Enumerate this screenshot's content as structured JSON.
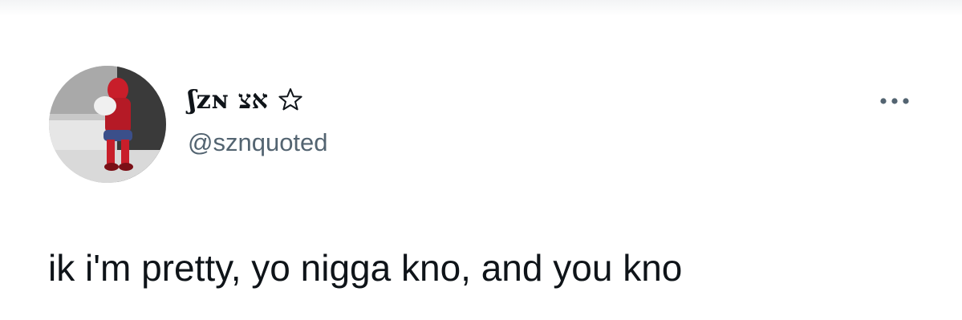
{
  "tweet": {
    "author": {
      "display_name": "ʃzɴ אצ",
      "badge_icon": "star-outline-icon",
      "handle": "@sznquoted",
      "avatar_icon": "profile-photo"
    },
    "menu_icon": "more-options-icon",
    "text": "ik i'm pretty, yo nigga kno, and you kno"
  }
}
